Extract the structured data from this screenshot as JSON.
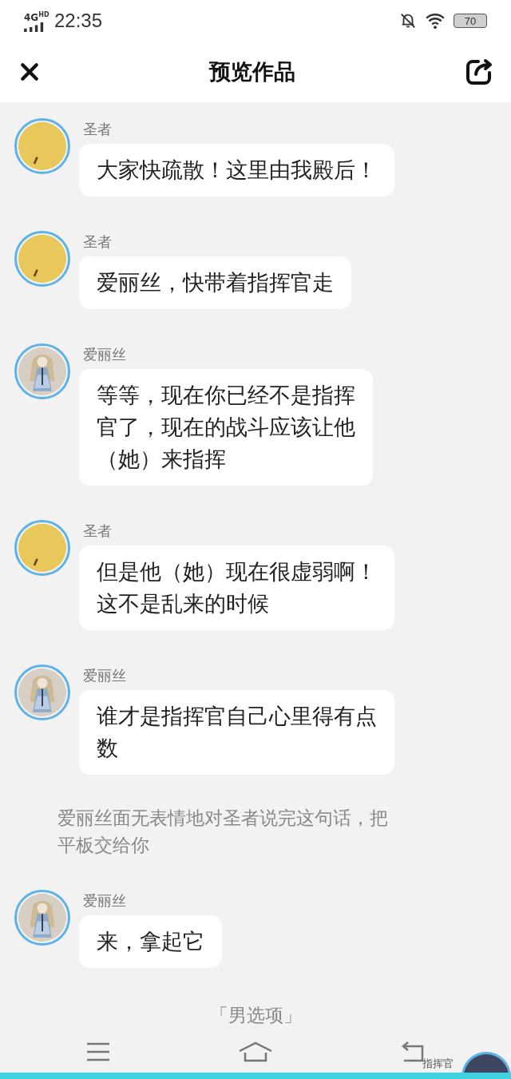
{
  "status_bar": {
    "network": "4G",
    "network_sub": "HD",
    "time": "22:35",
    "battery": "70"
  },
  "header": {
    "title": "预览作品"
  },
  "feed": [
    {
      "kind": "message",
      "speaker": "圣者",
      "avatar": {
        "kind": "plain"
      },
      "lines": [
        "大家快疏散！这里由我殿后！"
      ]
    },
    {
      "kind": "message",
      "speaker": "圣者",
      "avatar": {
        "kind": "plain"
      },
      "lines": [
        "爱丽丝，快带着指挥官走"
      ]
    },
    {
      "kind": "message",
      "speaker": "爱丽丝",
      "avatar": {
        "kind": "portrait"
      },
      "lines": [
        "等等，现在你已经不是指挥",
        "官了，现在的战斗应该让他",
        "（她）来指挥"
      ]
    },
    {
      "kind": "message",
      "speaker": "圣者",
      "avatar": {
        "kind": "plain"
      },
      "lines": [
        "但是他（她）现在很虚弱啊！",
        "这不是乱来的时候"
      ]
    },
    {
      "kind": "message",
      "speaker": "爱丽丝",
      "avatar": {
        "kind": "portrait"
      },
      "lines": [
        "谁才是指挥官自己心里得有点",
        "数"
      ]
    },
    {
      "kind": "narration",
      "lines": [
        "爱丽丝面无表情地对圣者说完这句话，把",
        "平板交给你"
      ]
    },
    {
      "kind": "message",
      "speaker": "爱丽丝",
      "avatar": {
        "kind": "portrait"
      },
      "lines": [
        "来，拿起它"
      ]
    }
  ],
  "choice_hint": "「男选项」",
  "player": {
    "label": "指挥官"
  }
}
